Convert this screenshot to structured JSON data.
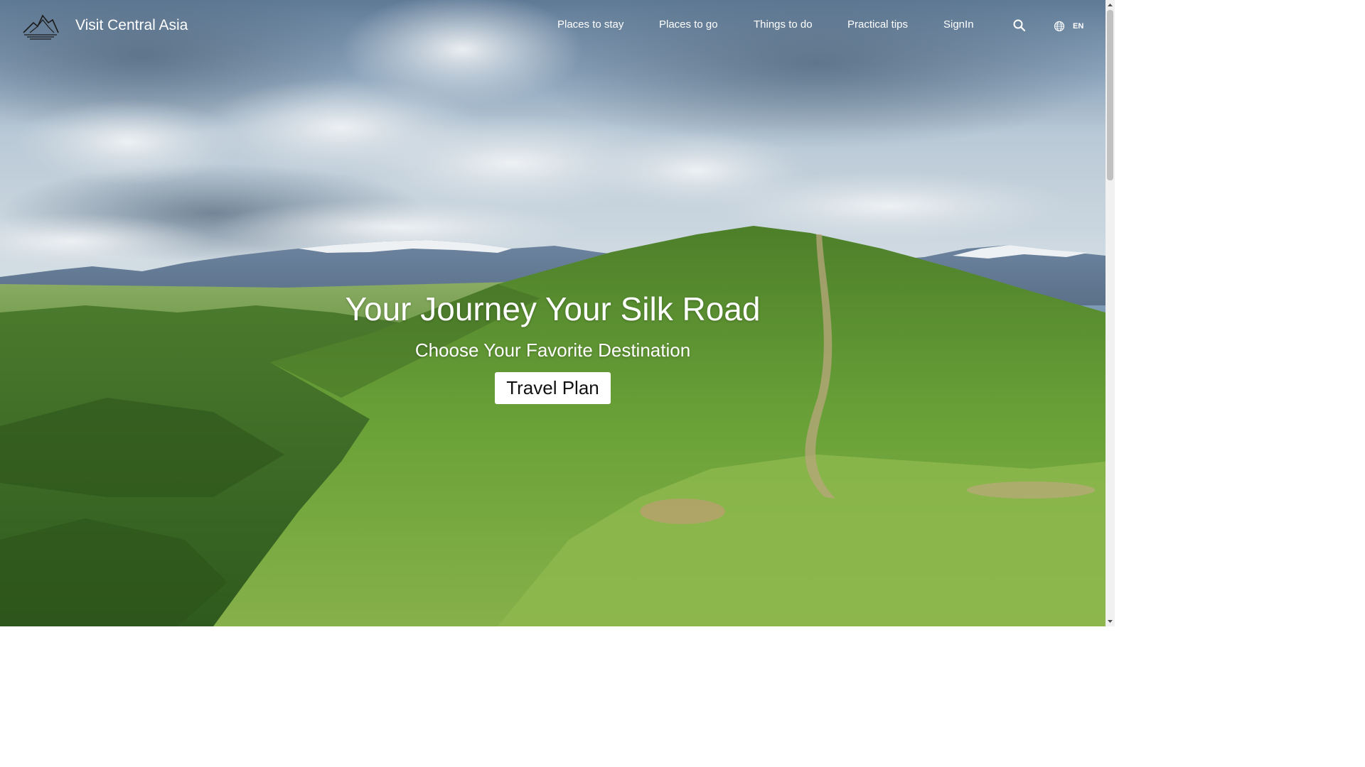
{
  "header": {
    "brand": "Visit Central Asia",
    "logo_icon": "mountain-logo-icon",
    "nav": [
      {
        "label": "Places to stay"
      },
      {
        "label": "Places to go"
      },
      {
        "label": "Things to do"
      },
      {
        "label": "Practical tips"
      },
      {
        "label": "SignIn"
      }
    ],
    "search_icon": "search-icon",
    "language": {
      "icon": "globe-icon",
      "label": "EN"
    }
  },
  "hero": {
    "title": "Your Journey Your Silk Road",
    "subtitle": "Choose Your Favorite Destination",
    "cta_label": "Travel Plan",
    "background": "green-hills-mountains-photo"
  },
  "colors": {
    "text": "#ffffff",
    "button_bg": "#ffffff",
    "button_text": "#111111",
    "grass": "#5c9a34",
    "sky": "#8fa9c0"
  }
}
